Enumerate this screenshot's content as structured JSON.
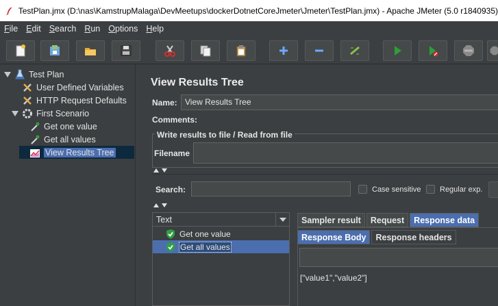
{
  "window": {
    "title": "TestPlan.jmx (D:\\nas\\KamstrupMalaga\\DevMeetups\\dockerDotnetCoreJmeter\\Jmeter\\TestPlan.jmx) - Apache JMeter (5.0 r1840935)"
  },
  "menu": [
    {
      "u": "F",
      "rest": "ile"
    },
    {
      "u": "E",
      "rest": "dit"
    },
    {
      "u": "S",
      "rest": "earch"
    },
    {
      "u": "R",
      "rest": "un"
    },
    {
      "u": "O",
      "rest": "ptions"
    },
    {
      "u": "H",
      "rest": "elp"
    }
  ],
  "toolbar": {
    "icons": [
      "new-file-icon",
      "templates-icon",
      "open-icon",
      "save-icon",
      "cut-icon",
      "copy-icon",
      "paste-icon",
      "expand-icon",
      "collapse-icon",
      "toggle-icon",
      "start-icon",
      "start-no-pauses-icon",
      "stop-icon",
      "shutdown-icon"
    ]
  },
  "tree": {
    "items": [
      {
        "label": "Test Plan",
        "level": 0,
        "icon": "flask-icon",
        "toggle": "expanded"
      },
      {
        "label": "User Defined Variables",
        "level": 1,
        "icon": "wrench-icon",
        "toggle": "none"
      },
      {
        "label": "HTTP Request Defaults",
        "level": 1,
        "icon": "wrench-icon",
        "toggle": "none"
      },
      {
        "label": "First Scenario",
        "level": 1,
        "icon": "gear-icon",
        "toggle": "expanded"
      },
      {
        "label": "Get one value",
        "level": 2,
        "icon": "pipette-icon",
        "toggle": "none"
      },
      {
        "label": "Get all values",
        "level": 2,
        "icon": "pipette-icon",
        "toggle": "none"
      },
      {
        "label": "View Results Tree",
        "level": 2,
        "icon": "chart-icon",
        "toggle": "none",
        "selected": true
      }
    ]
  },
  "panel": {
    "title": "View Results Tree",
    "name_label": "Name:",
    "name_value": "View Results Tree",
    "comments_label": "Comments:",
    "file_group_title": "Write results to file / Read from file",
    "filename_label": "Filename",
    "search_label": "Search:",
    "search_value": "",
    "case_sensitive_label": "Case sensitive",
    "regular_exp_label": "Regular exp."
  },
  "results": {
    "renderer": "Text",
    "items": [
      {
        "label": "Get one value",
        "status": "success"
      },
      {
        "label": "Get all values",
        "status": "success",
        "selected": true
      }
    ]
  },
  "tabs": {
    "main": [
      {
        "label": "Sampler result",
        "active": false
      },
      {
        "label": "Request",
        "active": false
      },
      {
        "label": "Response data",
        "active": true
      }
    ],
    "sub": [
      {
        "label": "Response Body",
        "active": true
      },
      {
        "label": "Response headers",
        "active": false
      }
    ]
  },
  "response": {
    "body": "[\"value1\",\"value2\"]"
  },
  "colors": {
    "background": "#3c3f41",
    "selection": "#4b6eaf",
    "success": "#2ea043"
  }
}
